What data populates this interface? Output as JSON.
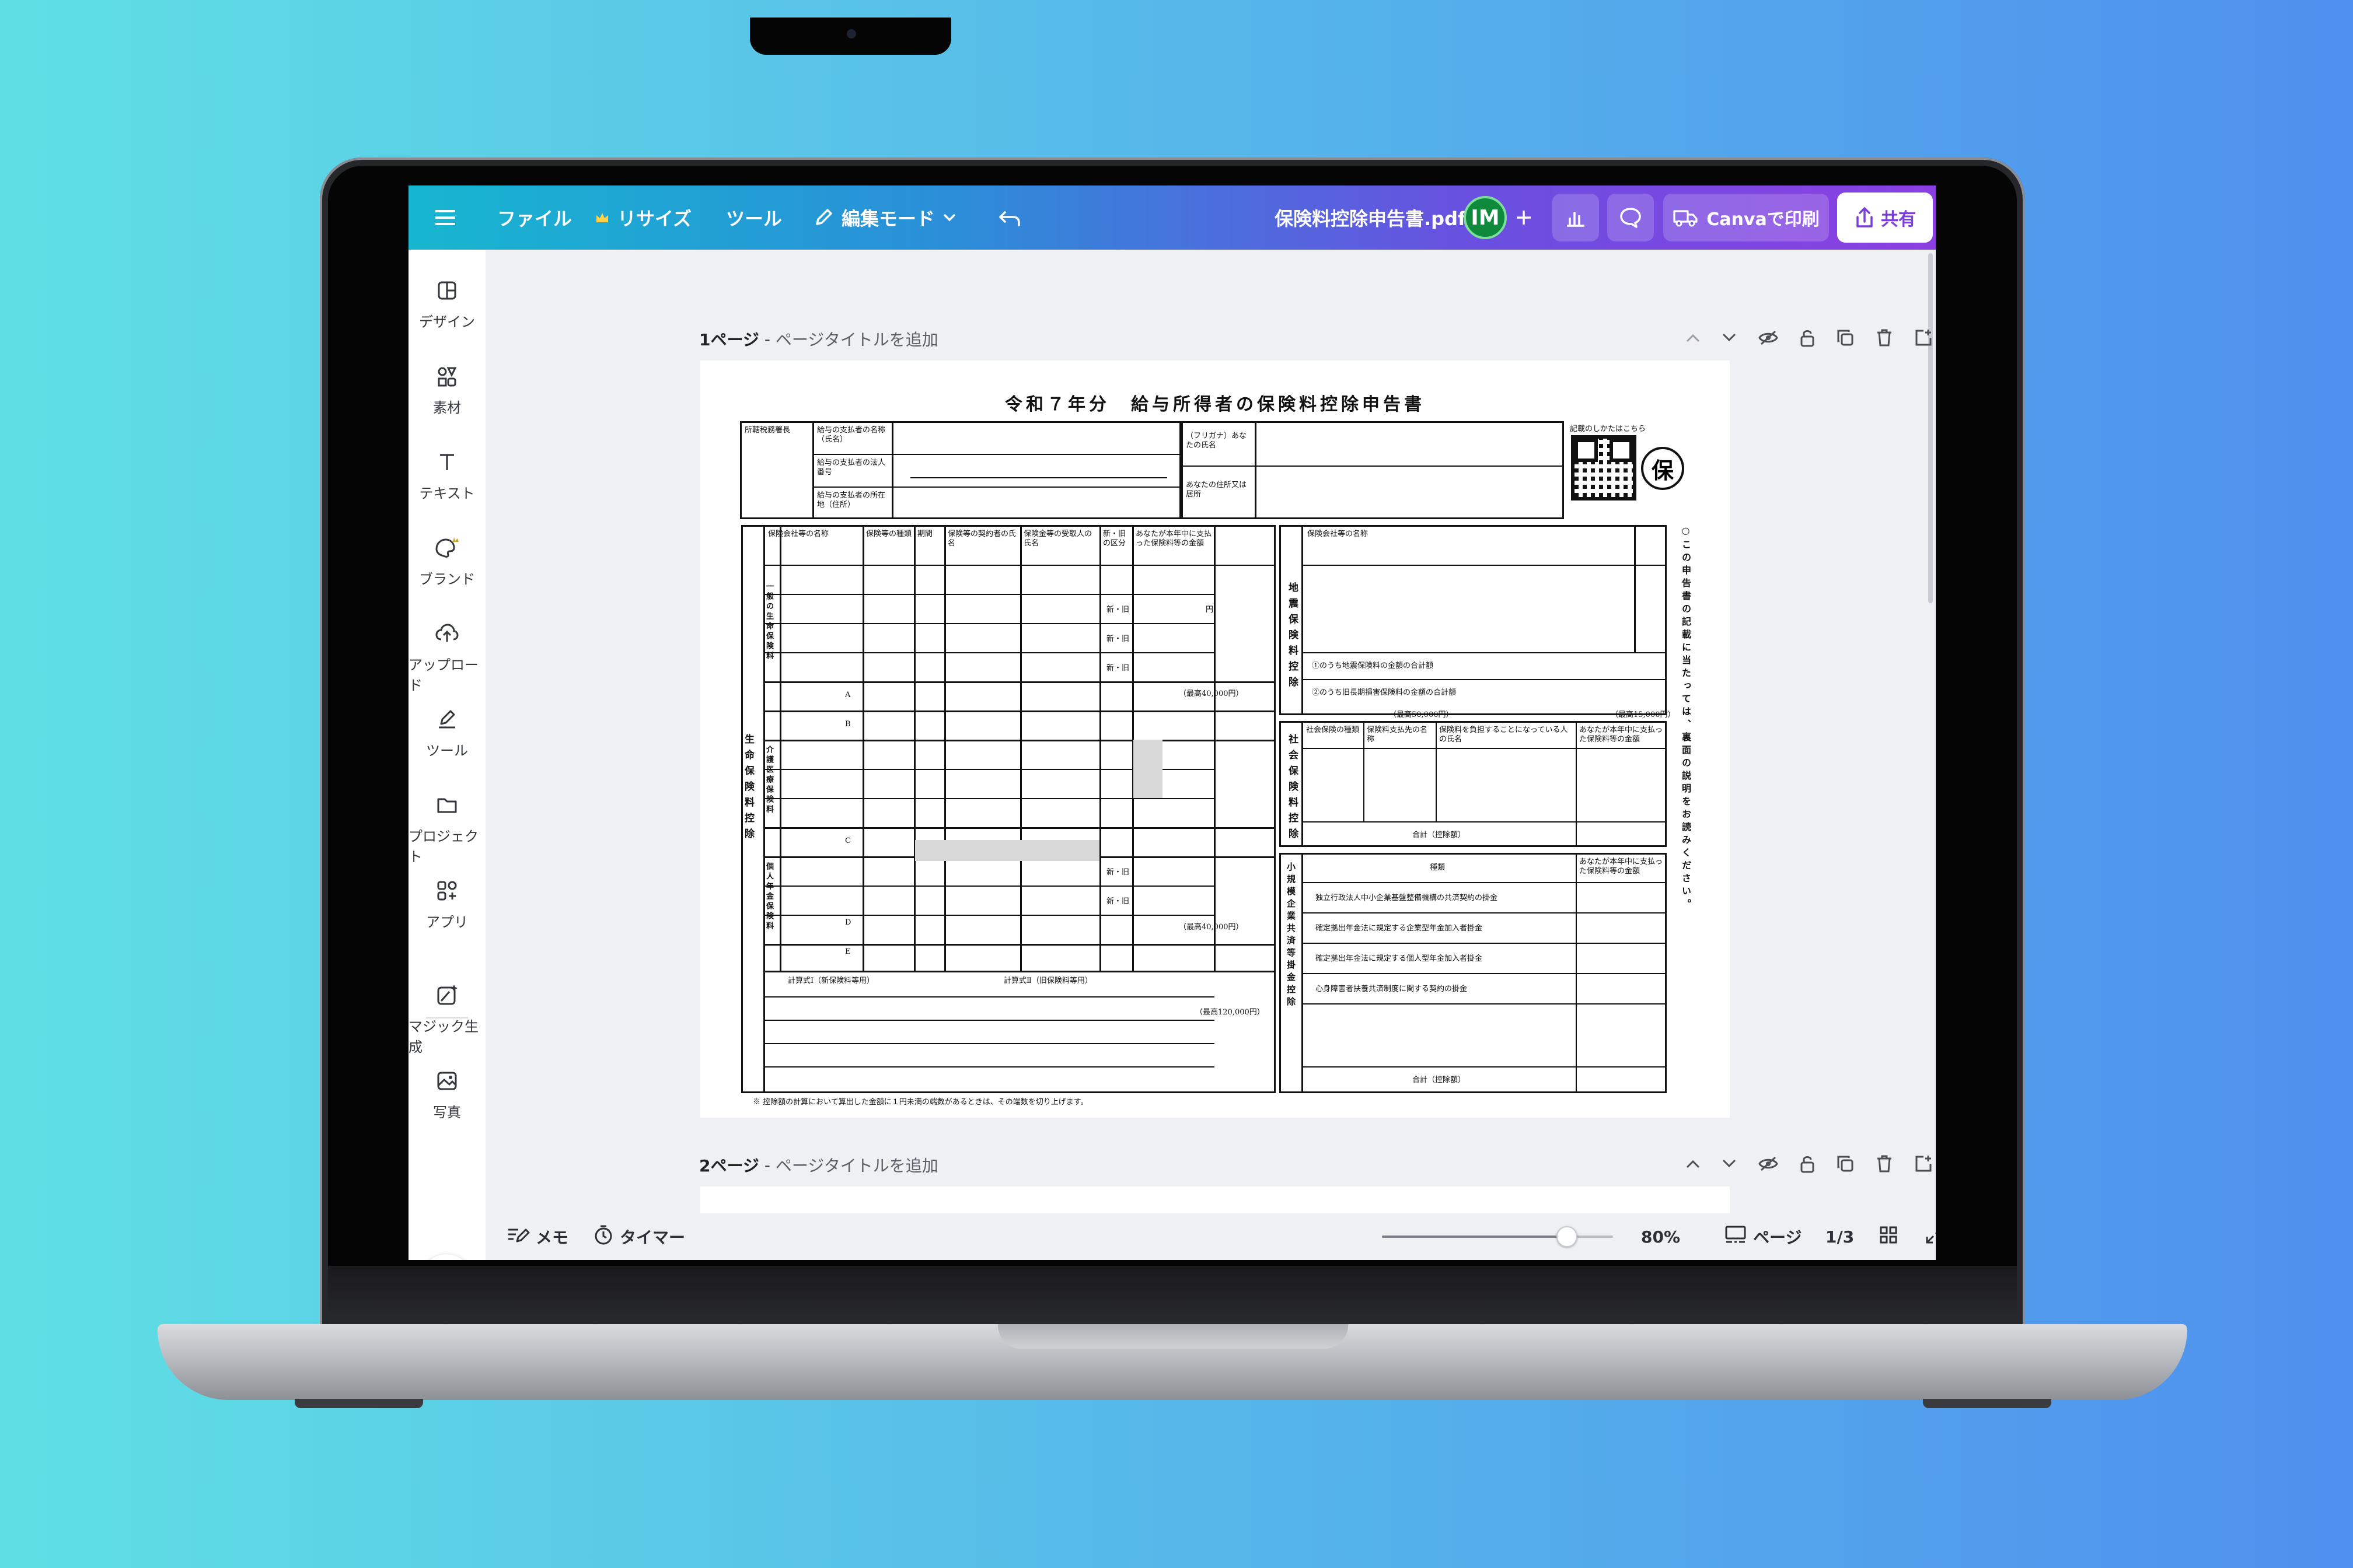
{
  "topbar": {
    "menu_icon": "hamburger-icon",
    "file_label": "ファイル",
    "resize_label": "リサイズ",
    "tools_label": "ツール",
    "edit_mode_label": "編集モード",
    "doc_title": "保険料控除申告書.pdf",
    "avatar_initials": "IM",
    "print_label": "Canvaで印刷",
    "share_label": "共有",
    "colors": {
      "start": "#17b6d0",
      "end": "#8b3fe2",
      "avatar": "#0f8a3c"
    }
  },
  "sidebar": {
    "items": [
      {
        "label": "デザイン",
        "icon": "design-icon"
      },
      {
        "label": "素材",
        "icon": "elements-icon"
      },
      {
        "label": "テキスト",
        "icon": "text-icon"
      },
      {
        "label": "ブランド",
        "icon": "brand-icon"
      },
      {
        "label": "アップロード",
        "icon": "upload-icon"
      },
      {
        "label": "ツール",
        "icon": "pen-tool-icon"
      },
      {
        "label": "プロジェクト",
        "icon": "folder-icon"
      },
      {
        "label": "アプリ",
        "icon": "apps-icon"
      },
      {
        "label": "マジック生成",
        "icon": "magic-media-icon"
      },
      {
        "label": "写真",
        "icon": "photo-icon"
      }
    ]
  },
  "pages": [
    {
      "number": "1ページ",
      "title_placeholder": "ページタイトルを追加"
    },
    {
      "number": "2ページ",
      "title_placeholder": "ページタイトルを追加"
    }
  ],
  "document": {
    "form_title": "令和７年分　給与所得者の保険料控除申告書",
    "seal_char": "保",
    "labels": {
      "payer_name": "給与の支払者の名称（氏名）",
      "payer_number": "給与の支払者の法人番号",
      "payer_address": "給与の支払者の所在地（住所）",
      "tax_office": "所轄税務署長",
      "furigana": "（フリガナ）あなたの氏名",
      "your_address": "あなたの住所又は居所",
      "qr_note": "記載のしかたはこちら",
      "insurer_name": "保険会社等の名称",
      "insurance_type": "保険等の種類",
      "period": "期間",
      "contractor": "保険等の契約者の氏名",
      "beneficiary": "保険金等の受取人の氏名",
      "new_old": "新・旧の区分",
      "premium": "あなたが本年中に支払った保険料等の金額",
      "new_short": "新・旧",
      "earthquake_total": "①のうち地震保険料の金額の合計額",
      "long_term_total": "②のうち旧長期損害保険料の金額の合計額",
      "social_type": "社会保険の種類",
      "social_payee": "保険料支払先の名称",
      "social_bearer": "保険料を負担することになっている人の氏名",
      "total_deduction": "合計（控除額）",
      "kind": "種類",
      "small_biz_1": "独立行政法人中小企業基盤整備機構の共済契約の掛金",
      "small_biz_2": "確定拠出年金法に規定する企業型年金加入者掛金",
      "small_biz_3": "確定拠出年金法に規定する個人型年金加入者掛金",
      "small_biz_4": "心身障害者扶養共済制度に関する契約の掛金",
      "footnote": "※ 控除額の計算において算出した金額に１円未満の端数があるときは、その端数を切り上げます。",
      "side_note": "○この申告書の記載に当たっては、裏面の説明をお読みください。",
      "life_section": "生命保険料控除",
      "general_life": "一般の生命保険料",
      "care_medical": "介護医療保険料",
      "pension": "個人年金保険料",
      "earthquake_section": "地震保険料控除",
      "social_section": "社会保険料控除",
      "small_biz_section": "小規模企業共済等掛金控除",
      "calc1": "計算式Ⅰ（新保険料等用）",
      "calc2": "計算式Ⅱ（旧保険料等用）",
      "max_40000": "（最高40,000円）",
      "max_50000": "（最高50,000円）",
      "max_15000": "（最高15,000円）",
      "max_120000": "（最高120,000円）",
      "yen": "円",
      "row_a": "A",
      "row_b": "B",
      "row_c": "C",
      "row_d": "D",
      "row_e": "E"
    }
  },
  "bottombar": {
    "notes_label": "メモ",
    "timer_label": "タイマー",
    "zoom_value": 80,
    "zoom_label": "80%",
    "pages_label": "ページ",
    "page_count": "1/3",
    "help_icon": "help-icon"
  }
}
